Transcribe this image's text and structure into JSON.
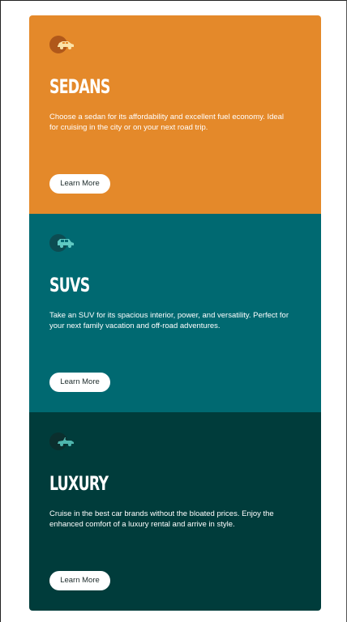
{
  "cards": [
    {
      "title": "SEDANS",
      "description": "Choose a sedan for its affordability and excellent fuel economy. Ideal for cruising in the city or on your next road trip.",
      "button_label": "Learn More",
      "icon": "sedan-car-icon",
      "color": "#e4892a"
    },
    {
      "title": "SUVS",
      "description": "Take an SUV for its spacious interior, power, and versatility. Perfect for your next family vacation and off-road adventures.",
      "button_label": "Learn More",
      "icon": "suv-icon",
      "color": "#006971"
    },
    {
      "title": "LUXURY",
      "description": "Cruise in the best car brands without the bloated prices. Enjoy the enhanced comfort of a luxury rental and arrive in style.",
      "button_label": "Learn More",
      "icon": "convertible-car-icon",
      "color": "#003c3b"
    }
  ]
}
